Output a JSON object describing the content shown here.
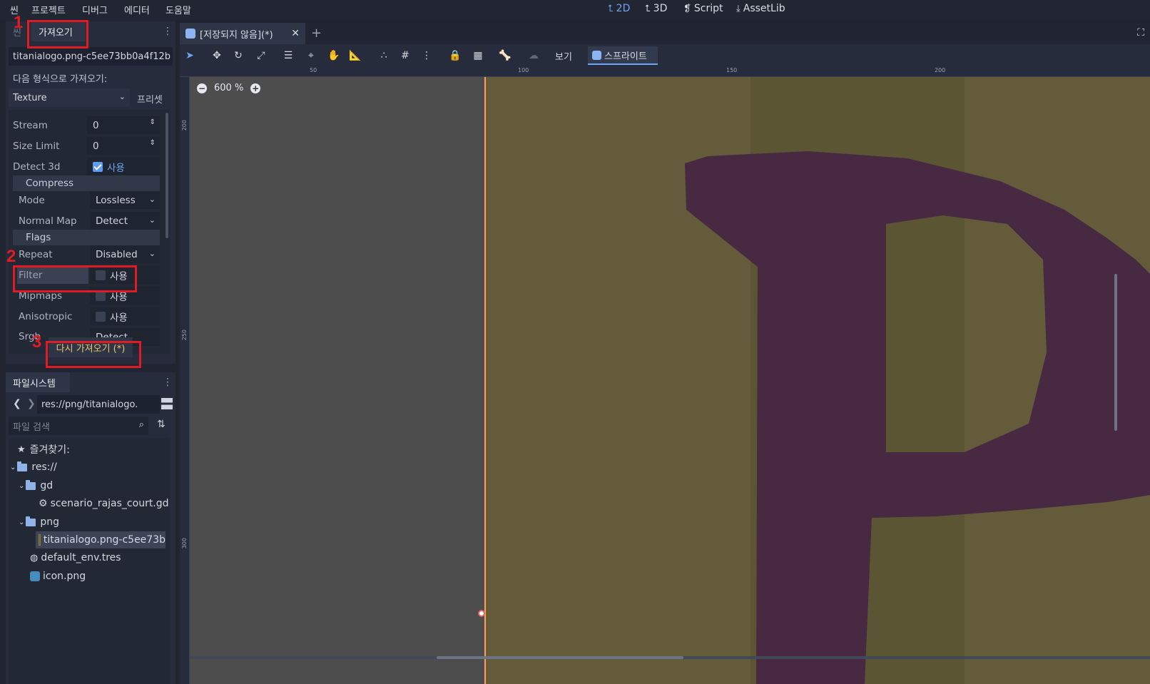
{
  "menubar": {
    "items": [
      "씬",
      "프로젝트",
      "디버그",
      "에디터",
      "도움말"
    ],
    "modes": [
      {
        "label": "2D",
        "icon": "2d-icon",
        "active": true
      },
      {
        "label": "3D",
        "icon": "3d-icon",
        "active": false
      },
      {
        "label": "Script",
        "icon": "script-icon",
        "active": false
      },
      {
        "label": "AssetLib",
        "icon": "assetlib-icon",
        "active": false
      }
    ]
  },
  "import_dock": {
    "tabs": [
      "씬",
      "가져오기"
    ],
    "file": "titanialogo.png-c5ee73bb0a4f12b",
    "import_as_label": "다음 형식으로 가져오기:",
    "import_type": "Texture",
    "preset_label": "프리셋",
    "properties": {
      "stream": {
        "label": "Stream",
        "value": "0"
      },
      "size_limit": {
        "label": "Size Limit",
        "value": "0"
      },
      "detect_3d": {
        "label": "Detect 3d",
        "value": "사용"
      },
      "compress_section": "Compress",
      "mode": {
        "label": "Mode",
        "value": "Lossless"
      },
      "normal_map": {
        "label": "Normal Map",
        "value": "Detect"
      },
      "flags_section": "Flags",
      "repeat": {
        "label": "Repeat",
        "value": "Disabled"
      },
      "filter": {
        "label": "Filter",
        "value": "사용"
      },
      "mipmaps": {
        "label": "Mipmaps",
        "value": "사용"
      },
      "anisotropic": {
        "label": "Anisotropic",
        "value": "사용"
      },
      "srgb": {
        "label": "Srgb",
        "value": "Detect"
      }
    },
    "reimport_button": "다시 가져오기 (*)"
  },
  "annotations": [
    "1",
    "2",
    "3"
  ],
  "filesystem": {
    "tab": "파일시스템",
    "path": "res://png/titanialogo.",
    "search_placeholder": "파일 검색",
    "tree": {
      "favorites": "즐겨찾기:",
      "root": "res://",
      "gd_folder": "gd",
      "gd_file": "scenario_rajas_court.gd",
      "png_folder": "png",
      "png_file": "titanialogo.png-c5ee73b",
      "env_file": "default_env.tres",
      "icon_file": "icon.png"
    }
  },
  "editor": {
    "scene_tab": "[저장되지 않음](*)",
    "toolbar": {
      "view_label": "보기",
      "sprite_label": "스프라이트"
    },
    "zoom": "600 %",
    "ruler_h": [
      "50",
      "100",
      "150",
      "200"
    ],
    "ruler_v": [
      "200",
      "250",
      "300"
    ]
  },
  "colors": {
    "accent": "#6ea4f4",
    "annotation_red": "#e01b24",
    "sprite_bg": "#635b3a",
    "sprite_letter": "#472942",
    "origin_line": "#ff9f5a"
  }
}
